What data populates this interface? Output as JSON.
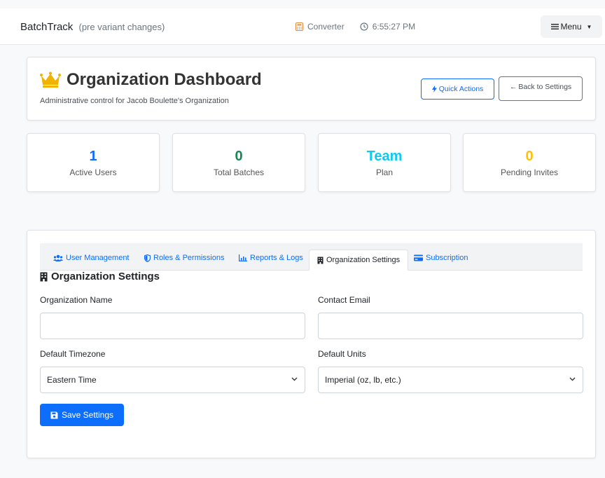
{
  "navbar": {
    "brand": "BatchTrack",
    "brand_sub": "(pre variant changes)",
    "converter_label": "Converter",
    "time": "6:55:27 PM",
    "menu_label": "Menu"
  },
  "header": {
    "title": "Organization Dashboard",
    "subtitle": "Administrative control for Jacob Boulette's Organization",
    "quick_actions_label": "Quick Actions",
    "back_label": "Back to Settings",
    "crown_color": "#f0b400"
  },
  "stats": [
    {
      "value": "1",
      "label": "Active Users",
      "color": "#0d6efd"
    },
    {
      "value": "0",
      "label": "Total Batches",
      "color": "#198754"
    },
    {
      "value": "Team",
      "label": "Plan",
      "color": "#0dcaf0"
    },
    {
      "value": "0",
      "label": "Pending Invites",
      "color": "#ffc107"
    }
  ],
  "tabs": [
    {
      "label": "User Management",
      "icon": "users-icon"
    },
    {
      "label": "Roles & Permissions",
      "icon": "shield-icon"
    },
    {
      "label": "Reports & Logs",
      "icon": "chart-icon"
    },
    {
      "label": "Organization Settings",
      "icon": "building-icon",
      "active": true
    },
    {
      "label": "Subscription",
      "icon": "credit-card-icon"
    }
  ],
  "settings": {
    "section_title": "Organization Settings",
    "org_name_label": "Organization Name",
    "org_name_value": "",
    "contact_email_label": "Contact Email",
    "contact_email_value": "",
    "timezone_label": "Default Timezone",
    "timezone_value": "Eastern Time",
    "units_label": "Default Units",
    "units_value": "Imperial (oz, lb, etc.)",
    "save_label": "Save Settings"
  },
  "colors": {
    "primary": "#0d6efd"
  }
}
